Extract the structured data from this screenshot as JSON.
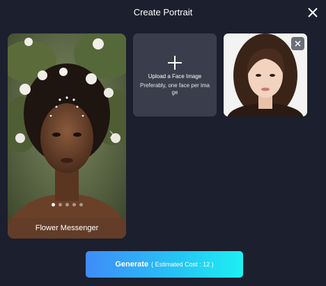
{
  "dialog": {
    "title": "Create Portrait"
  },
  "template": {
    "label": "Flower Messenger",
    "carousel_dots": 5,
    "active_dot": 0
  },
  "upload": {
    "title": "Upload a Face Image",
    "hint": "Preferably, one face per image"
  },
  "face": {
    "description_icon": "uploaded-face-photo"
  },
  "generate": {
    "label": "Generate",
    "cost_text": "( Estimated Cost : 12 )"
  },
  "colors": {
    "background": "#1c1f2e",
    "card": "#3a3d4b",
    "button_gradient_start": "#3f8cf9",
    "button_gradient_end": "#1df0f2"
  }
}
